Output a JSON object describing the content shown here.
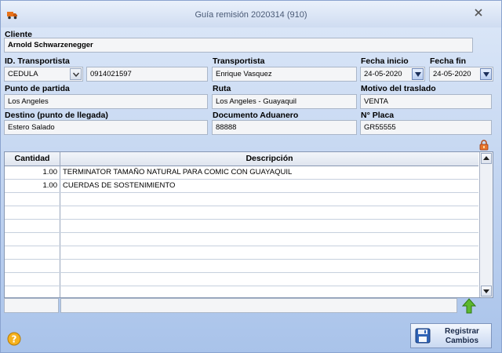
{
  "window": {
    "title": "Guía remisión 2020314 (910)"
  },
  "cliente": {
    "label": "Cliente",
    "value": "Arnold Schwarzenegger"
  },
  "id_transportista": {
    "label": "ID. Transportista",
    "type_value": "CEDULA",
    "value": "0914021597"
  },
  "transportista": {
    "label": "Transportista",
    "value": "Enrique Vasquez"
  },
  "fecha_inicio": {
    "label": "Fecha inicio",
    "value": "24-05-2020"
  },
  "fecha_fin": {
    "label": "Fecha fin",
    "value": "24-05-2020"
  },
  "punto_partida": {
    "label": "Punto de partida",
    "value": "Los Angeles"
  },
  "ruta": {
    "label": "Ruta",
    "value": "Los Angeles - Guayaquil"
  },
  "motivo": {
    "label": "Motivo del traslado",
    "value": "VENTA"
  },
  "destino": {
    "label": "Destino (punto de llegada)",
    "value": "Estero Salado"
  },
  "documento": {
    "label": "Documento Aduanero",
    "value": "88888"
  },
  "placa": {
    "label": "N° Placa",
    "value": "GR55555"
  },
  "grid": {
    "headers": {
      "cantidad": "Cantidad",
      "descripcion": "Descripción"
    },
    "rows": [
      {
        "cantidad": "1.00",
        "descripcion": "TERMINATOR TAMAÑO NATURAL PARA COMIC CON GUAYAQUIL"
      },
      {
        "cantidad": "1.00",
        "descripcion": "CUERDAS DE SOSTENIMIENTO"
      }
    ]
  },
  "footer": {
    "save_label_1": "Registrar",
    "save_label_2": "Cambios"
  },
  "colors": {
    "accent": "#3b6fc2",
    "window_bg": "#c4d6f0",
    "field_bg": "#f4f5f7"
  }
}
